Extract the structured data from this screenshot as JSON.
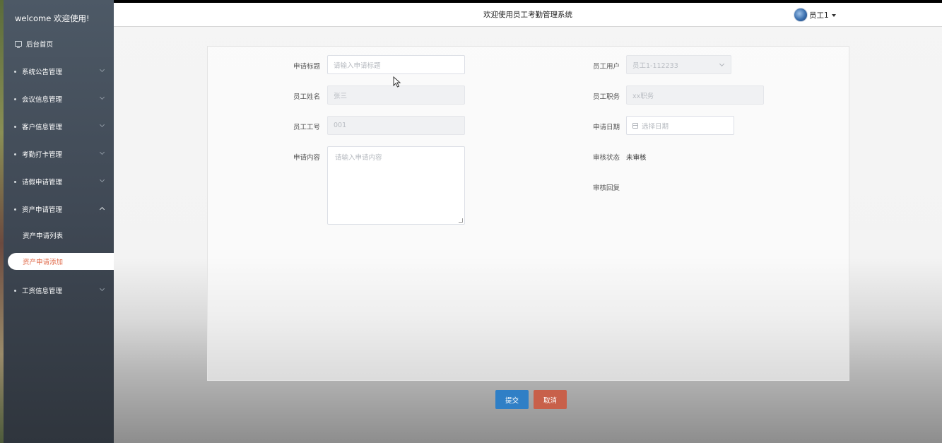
{
  "sidebar": {
    "welcome": "welcome 欢迎使用!",
    "home": "后台首页",
    "menu": [
      {
        "label": "系统公告管理"
      },
      {
        "label": "会议信息管理"
      },
      {
        "label": "客户信息管理"
      },
      {
        "label": "考勤打卡管理"
      },
      {
        "label": "请假申请管理"
      },
      {
        "label": "资产申请管理"
      },
      {
        "label": "工资信息管理"
      }
    ],
    "sub_items": [
      {
        "label": "资产申请列表"
      },
      {
        "label": "资产申请添加"
      }
    ]
  },
  "header": {
    "title": "欢迎使用员工考勤管理系统",
    "user": "员工1"
  },
  "form": {
    "title_label": "申请标题",
    "title_placeholder": "请输入申请标题",
    "user_label": "员工用户",
    "user_value": "员工1-112233",
    "name_label": "员工姓名",
    "name_value": "张三",
    "position_label": "员工职务",
    "position_value": "xx职务",
    "number_label": "员工工号",
    "number_value": "001",
    "date_label": "申请日期",
    "date_placeholder": "选择日期",
    "content_label": "申请内容",
    "content_placeholder": "请输入申请内容",
    "status_label": "审核状态",
    "status_value": "未审核",
    "reply_label": "审核回复"
  },
  "buttons": {
    "submit": "提交",
    "cancel": "取消"
  },
  "colors": {
    "sidebar_bg": "#4d5966",
    "active_text": "#e06a4a",
    "submit_bg": "#2f7fc6",
    "cancel_bg": "#c8604a"
  }
}
